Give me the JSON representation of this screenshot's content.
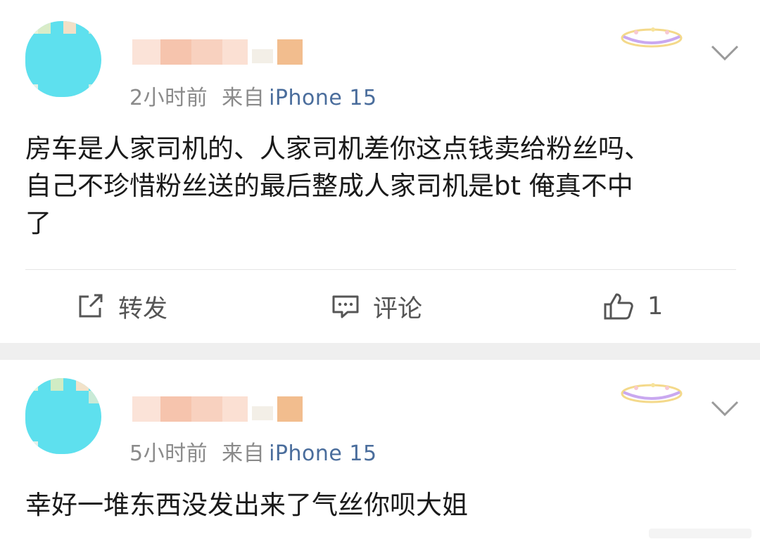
{
  "posts": [
    {
      "time": "2小时前",
      "source_prefix": "来自",
      "source_device": "iPhone 15",
      "content_lines": [
        "房车是人家司机的、人家司机差你这点钱卖给粉丝吗、",
        "自己不珍惜粉丝送的最后整成人家司机是bt 俺真不中",
        "了"
      ],
      "actions": {
        "repost_label": "转发",
        "comment_label": "评论",
        "like_count": "1"
      },
      "icons": {
        "more": "chevron-down-icon",
        "repost": "share-square-icon",
        "comment": "comment-bubble-icon",
        "like": "thumbs-up-icon"
      }
    },
    {
      "time": "5小时前",
      "source_prefix": "来自",
      "source_device": "iPhone 15",
      "content_lines": [
        "幸好一堆东西没发出来了气丝你呗大姐"
      ],
      "icons": {
        "more": "chevron-down-icon"
      }
    }
  ],
  "colors": {
    "avatar": "#5ee0ee",
    "meta_text": "#8a8a8a",
    "source_link": "#4a6d9c",
    "separator": "#efefef",
    "action_text": "#555555"
  }
}
